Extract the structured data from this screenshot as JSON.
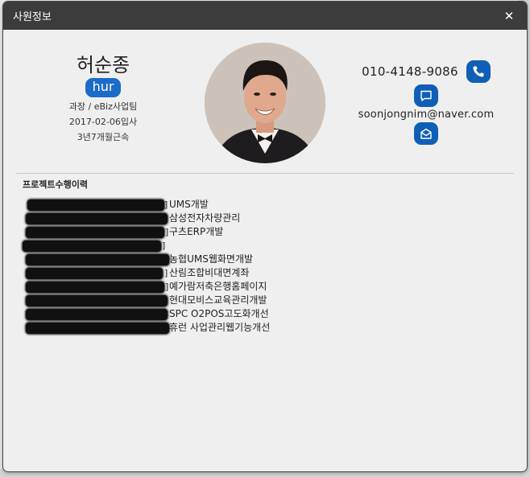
{
  "modal": {
    "title": "사원정보",
    "close_icon": "close-icon"
  },
  "employee": {
    "name": "허순종",
    "id": "hur",
    "position_team": "과장 / eBiz사업팀",
    "hire_date": "2017-02-06입사",
    "tenure": "3년7개월근속",
    "phone": "010-4148-9086",
    "email": "soonjongnim@naver.com"
  },
  "icons": {
    "phone": "phone-icon",
    "message": "message-icon",
    "mail": "mail-icon"
  },
  "projects": {
    "title": "프로젝트수행이력",
    "items": [
      {
        "name": "UMS개발",
        "bracket": true
      },
      {
        "name": "삼성전자차량관리",
        "bracket": false
      },
      {
        "name": "구츠ERP개발",
        "bracket": true
      },
      {
        "name": "",
        "bracket": true
      },
      {
        "name": "농협UMS웹화면개발",
        "bracket": false
      },
      {
        "name": "산림조합비대면계좌",
        "bracket": true
      },
      {
        "name": "예가람저축은행홈페이지",
        "bracket": true
      },
      {
        "name": "현대모비스교육관리개발",
        "bracket": false
      },
      {
        "name": "SPC O2POS고도화개선",
        "bracket": false
      },
      {
        "name": "휴런 사업관리웹기능개선",
        "bracket": false
      }
    ]
  },
  "colors": {
    "titlebar": "#3c3c3c",
    "accent": "#0f5fb6",
    "badge": "#1b6cc8"
  }
}
